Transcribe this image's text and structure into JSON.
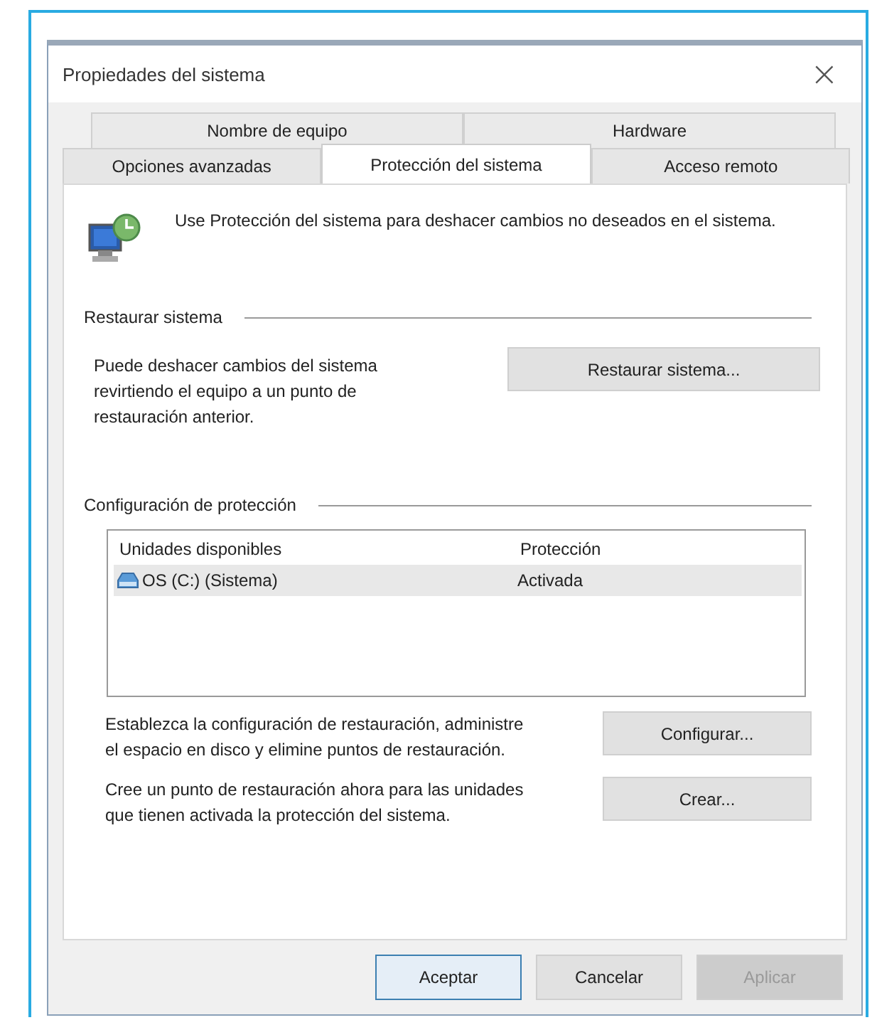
{
  "window": {
    "title": "Propiedades del sistema",
    "close": "×"
  },
  "tab_rows": [
    [
      {
        "label": "Nombre de equipo",
        "selected": false
      },
      {
        "label": "Hardware",
        "selected": false
      }
    ],
    [
      {
        "label": "Opciones avanzadas",
        "selected": false
      },
      {
        "label": "Protección del sistema",
        "selected": true
      },
      {
        "label": "Acceso remoto",
        "selected": false
      }
    ]
  ],
  "intro": "Use Protección del sistema para deshacer cambios no deseados en el sistema.",
  "restore": {
    "heading": "Restaurar sistema",
    "text": "Puede deshacer cambios del sistema revirtiendo el equipo a un punto de restauración anterior.",
    "button": {
      "label": "Restaurar sistema...",
      "disabled": false
    }
  },
  "protection": {
    "heading": "Configuración de protección",
    "table": {
      "columns": [
        "Unidades disponibles",
        "Protección"
      ],
      "rows": [
        {
          "drive": "OS (C:) (Sistema)",
          "protection": "Activada",
          "selected": true
        }
      ]
    },
    "actions": [
      {
        "text": "Establezca la configuración de restauración, administre el espacio en disco y elimine puntos de restauración.",
        "button": {
          "label": "Configurar...",
          "disabled": false
        }
      },
      {
        "text": "Cree un punto de restauración ahora para las unidades que tienen activada la protección del sistema.",
        "button": {
          "label": "Crear...",
          "disabled": false
        }
      }
    ]
  },
  "buttons": [
    {
      "label": "Aceptar",
      "default": true,
      "disabled": false
    },
    {
      "label": "Cancelar",
      "default": false,
      "disabled": false
    },
    {
      "label": "Aplicar",
      "default": false,
      "disabled": true
    }
  ]
}
